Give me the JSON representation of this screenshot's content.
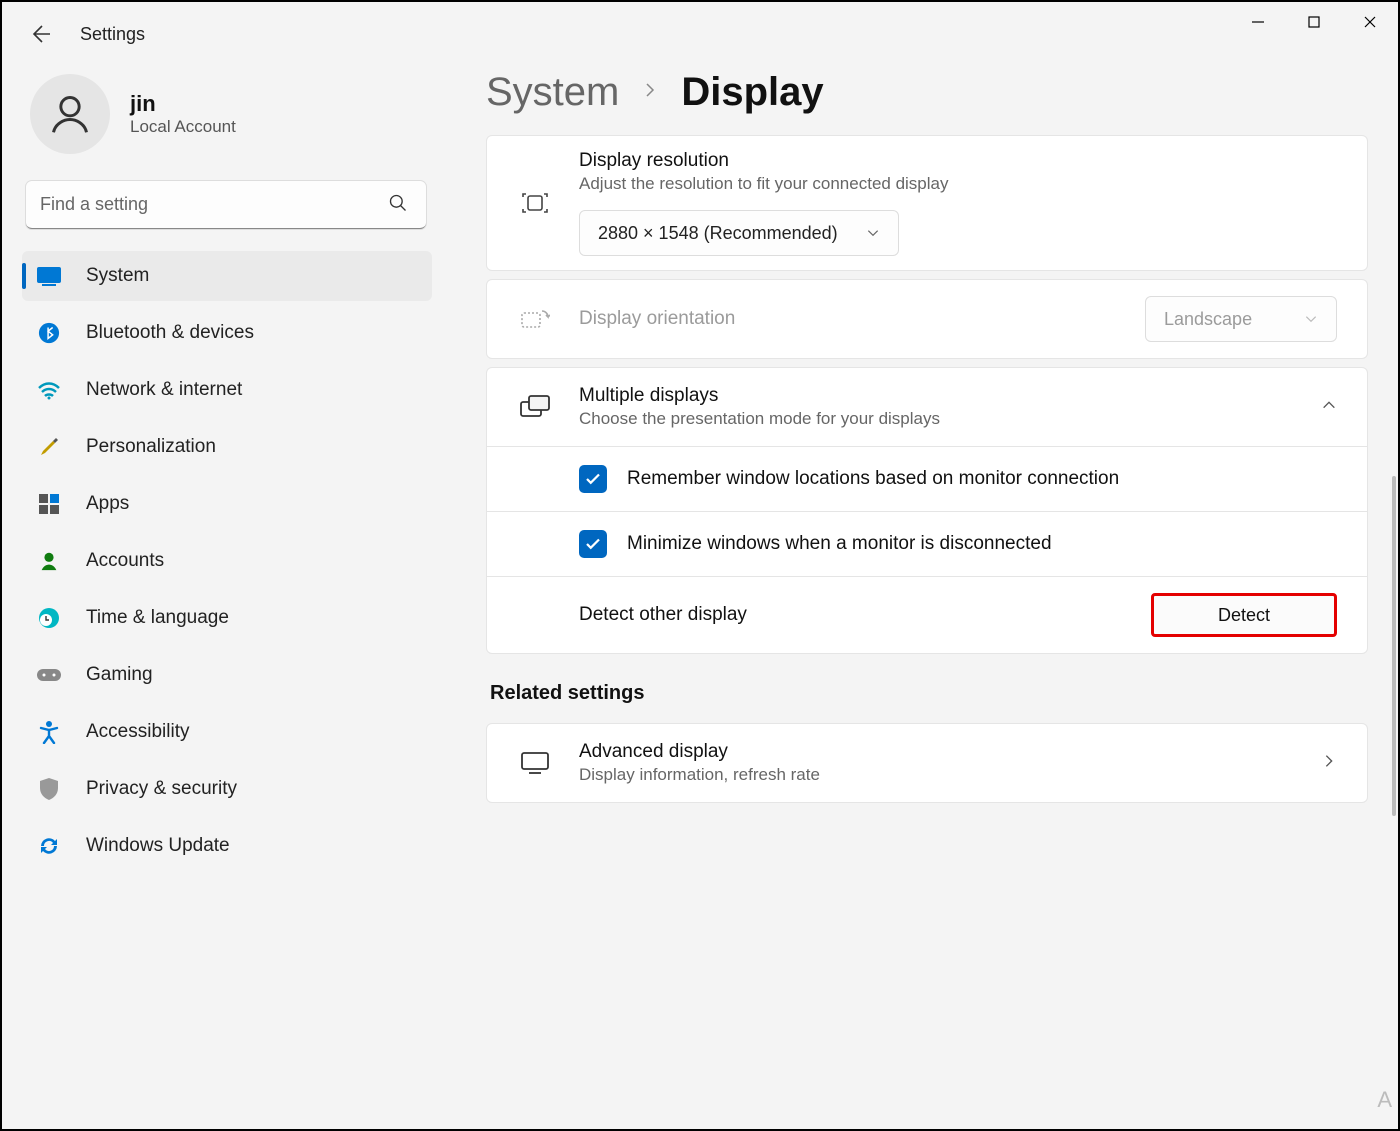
{
  "app_title": "Settings",
  "profile": {
    "name": "jin",
    "subtitle": "Local Account"
  },
  "search": {
    "placeholder": "Find a setting"
  },
  "nav": [
    {
      "key": "system",
      "label": "System",
      "active": true
    },
    {
      "key": "bluetooth",
      "label": "Bluetooth & devices"
    },
    {
      "key": "network",
      "label": "Network & internet"
    },
    {
      "key": "personalization",
      "label": "Personalization"
    },
    {
      "key": "apps",
      "label": "Apps"
    },
    {
      "key": "accounts",
      "label": "Accounts"
    },
    {
      "key": "time",
      "label": "Time & language"
    },
    {
      "key": "gaming",
      "label": "Gaming"
    },
    {
      "key": "accessibility",
      "label": "Accessibility"
    },
    {
      "key": "privacy",
      "label": "Privacy & security"
    },
    {
      "key": "update",
      "label": "Windows Update"
    }
  ],
  "breadcrumb": {
    "parent": "System",
    "current": "Display"
  },
  "resolution": {
    "title": "Display resolution",
    "subtitle": "Adjust the resolution to fit your connected display",
    "selected": "2880 × 1548 (Recommended)"
  },
  "orientation": {
    "title": "Display orientation",
    "selected": "Landscape"
  },
  "multiple": {
    "title": "Multiple displays",
    "subtitle": "Choose the presentation mode for your displays",
    "opt_remember": "Remember window locations based on monitor connection",
    "opt_minimize": "Minimize windows when a monitor is disconnected",
    "detect_label": "Detect other display",
    "detect_button": "Detect"
  },
  "related_heading": "Related settings",
  "advanced": {
    "title": "Advanced display",
    "subtitle": "Display information, refresh rate"
  }
}
